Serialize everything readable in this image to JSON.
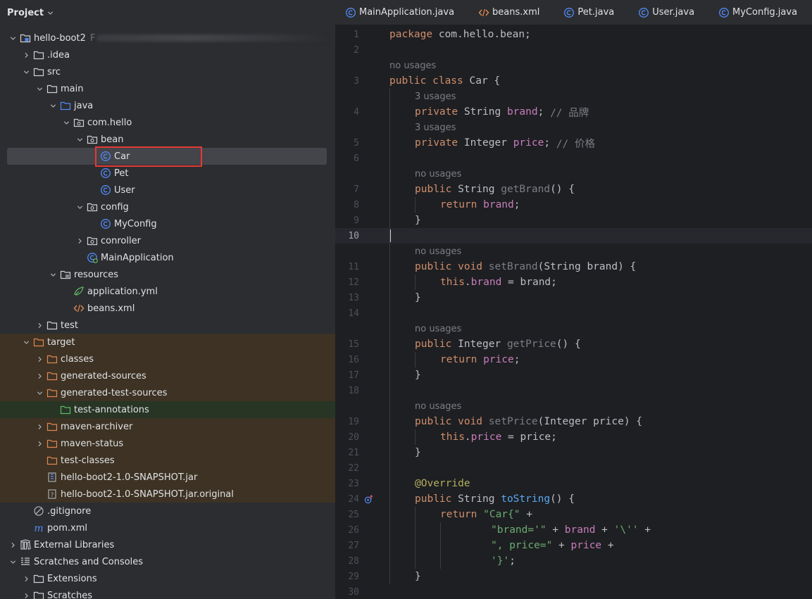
{
  "project_panel": {
    "title": "Project",
    "tree": [
      {
        "label": "hello-boot2",
        "suffix": "F",
        "icon": "module-folder-icon",
        "depth": 0,
        "expanded": true,
        "blurred_path": true
      },
      {
        "label": ".idea",
        "icon": "folder-icon",
        "depth": 1,
        "expanded": false
      },
      {
        "label": "src",
        "icon": "folder-icon",
        "depth": 1,
        "expanded": true
      },
      {
        "label": "main",
        "icon": "folder-icon",
        "depth": 2,
        "expanded": true
      },
      {
        "label": "java",
        "icon": "source-folder-icon",
        "depth": 3,
        "expanded": true
      },
      {
        "label": "com.hello",
        "icon": "package-icon",
        "depth": 4,
        "expanded": true
      },
      {
        "label": "bean",
        "icon": "package-icon",
        "depth": 5,
        "expanded": true
      },
      {
        "label": "Car",
        "icon": "class-icon",
        "depth": 6,
        "leaf": true,
        "selected": true
      },
      {
        "label": "Pet",
        "icon": "class-icon",
        "depth": 6,
        "leaf": true
      },
      {
        "label": "User",
        "icon": "class-icon",
        "depth": 6,
        "leaf": true
      },
      {
        "label": "config",
        "icon": "package-icon",
        "depth": 5,
        "expanded": true
      },
      {
        "label": "MyConfig",
        "icon": "class-icon",
        "depth": 6,
        "leaf": true
      },
      {
        "label": "conroller",
        "icon": "package-icon",
        "depth": 5,
        "expanded": false
      },
      {
        "label": "MainApplication",
        "icon": "spring-class-icon",
        "depth": 5,
        "leaf": true
      },
      {
        "label": "resources",
        "icon": "resources-folder-icon",
        "depth": 3,
        "expanded": true
      },
      {
        "label": "application.yml",
        "icon": "spring-config-icon",
        "depth": 4,
        "leaf": true
      },
      {
        "label": "beans.xml",
        "icon": "xml-icon",
        "depth": 4,
        "leaf": true
      },
      {
        "label": "test",
        "icon": "folder-icon",
        "depth": 2,
        "expanded": false
      },
      {
        "label": "target",
        "icon": "excluded-folder-icon",
        "depth": 1,
        "expanded": true,
        "bg": "target"
      },
      {
        "label": "classes",
        "icon": "excluded-folder-icon",
        "depth": 2,
        "expanded": false,
        "bg": "target"
      },
      {
        "label": "generated-sources",
        "icon": "excluded-folder-icon",
        "depth": 2,
        "expanded": false,
        "bg": "target"
      },
      {
        "label": "generated-test-sources",
        "icon": "excluded-folder-icon",
        "depth": 2,
        "expanded": true,
        "bg": "target"
      },
      {
        "label": "test-annotations",
        "icon": "generated-test-folder-icon",
        "depth": 3,
        "leaf": true,
        "bg": "green"
      },
      {
        "label": "maven-archiver",
        "icon": "excluded-folder-icon",
        "depth": 2,
        "expanded": false,
        "bg": "target"
      },
      {
        "label": "maven-status",
        "icon": "excluded-folder-icon",
        "depth": 2,
        "expanded": false,
        "bg": "target"
      },
      {
        "label": "test-classes",
        "icon": "excluded-folder-icon",
        "depth": 2,
        "leaf": true,
        "bg": "target"
      },
      {
        "label": "hello-boot2-1.0-SNAPSHOT.jar",
        "icon": "jar-icon",
        "depth": 2,
        "leaf": true,
        "bg": "target"
      },
      {
        "label": "hello-boot2-1.0-SNAPSHOT.jar.original",
        "icon": "unknown-file-icon",
        "depth": 2,
        "leaf": true,
        "bg": "target"
      },
      {
        "label": ".gitignore",
        "icon": "gitignore-icon",
        "depth": 1,
        "leaf": true
      },
      {
        "label": "pom.xml",
        "icon": "maven-icon",
        "depth": 1,
        "leaf": true
      },
      {
        "label": "External Libraries",
        "icon": "libraries-icon",
        "depth": 0,
        "expanded": false
      },
      {
        "label": "Scratches and Consoles",
        "icon": "scratches-icon",
        "depth": 0,
        "expanded": true
      },
      {
        "label": "Extensions",
        "icon": "folder-icon",
        "depth": 1,
        "expanded": false
      },
      {
        "label": "Scratches",
        "icon": "folder-icon",
        "depth": 1,
        "expanded": false
      }
    ]
  },
  "editor": {
    "tabs": [
      {
        "label": "MainApplication.java",
        "icon": "class-icon"
      },
      {
        "label": "beans.xml",
        "icon": "xml-icon"
      },
      {
        "label": "Pet.java",
        "icon": "class-icon"
      },
      {
        "label": "User.java",
        "icon": "class-icon"
      },
      {
        "label": "MyConfig.java",
        "icon": "class-icon"
      }
    ],
    "current_line": "10",
    "lines": [
      {
        "n": "1",
        "indent": 0,
        "parts": [
          [
            "kw",
            "package"
          ],
          [
            "code",
            " com.hello.bean;"
          ]
        ]
      },
      {
        "n": "2",
        "indent": 0,
        "parts": []
      },
      {
        "hint": "no usages",
        "indent": 0
      },
      {
        "n": "3",
        "indent": 0,
        "parts": [
          [
            "kw",
            "public class "
          ],
          [
            "cls",
            "Car "
          ],
          [
            "code",
            "{"
          ]
        ]
      },
      {
        "hint": "3 usages",
        "indent": 1
      },
      {
        "n": "4",
        "indent": 1,
        "parts": [
          [
            "kw",
            "private "
          ],
          [
            "code",
            "String "
          ],
          [
            "fld",
            "brand"
          ],
          [
            "code",
            "; "
          ],
          [
            "cmt",
            "// 品牌"
          ]
        ]
      },
      {
        "hint": "3 usages",
        "indent": 1
      },
      {
        "n": "5",
        "indent": 1,
        "parts": [
          [
            "kw",
            "private "
          ],
          [
            "code",
            "Integer "
          ],
          [
            "fld",
            "price"
          ],
          [
            "code",
            "; "
          ],
          [
            "cmt",
            "// 价格"
          ]
        ]
      },
      {
        "n": "6",
        "indent": 0,
        "parts": []
      },
      {
        "hint": "no usages",
        "indent": 1
      },
      {
        "n": "7",
        "indent": 1,
        "parts": [
          [
            "kw",
            "public "
          ],
          [
            "code",
            "String "
          ],
          [
            "cmt",
            "getBrand"
          ],
          [
            "code",
            "() {"
          ]
        ]
      },
      {
        "n": "8",
        "indent": 2,
        "parts": [
          [
            "kw",
            "return "
          ],
          [
            "fld",
            "brand"
          ],
          [
            "code",
            ";"
          ]
        ]
      },
      {
        "n": "9",
        "indent": 1,
        "parts": [
          [
            "code",
            "}"
          ]
        ]
      },
      {
        "n": "10",
        "indent": 0,
        "parts": [],
        "current": true
      },
      {
        "hint": "no usages",
        "indent": 1
      },
      {
        "n": "11",
        "indent": 1,
        "parts": [
          [
            "kw",
            "public void "
          ],
          [
            "cmt",
            "setBrand"
          ],
          [
            "code",
            "(String brand) {"
          ]
        ]
      },
      {
        "n": "12",
        "indent": 2,
        "parts": [
          [
            "kw",
            "this"
          ],
          [
            "code",
            "."
          ],
          [
            "fld",
            "brand"
          ],
          [
            "code",
            " = brand;"
          ]
        ]
      },
      {
        "n": "13",
        "indent": 1,
        "parts": [
          [
            "code",
            "}"
          ]
        ]
      },
      {
        "n": "14",
        "indent": 0,
        "parts": []
      },
      {
        "hint": "no usages",
        "indent": 1
      },
      {
        "n": "15",
        "indent": 1,
        "parts": [
          [
            "kw",
            "public "
          ],
          [
            "code",
            "Integer "
          ],
          [
            "cmt",
            "getPrice"
          ],
          [
            "code",
            "() {"
          ]
        ]
      },
      {
        "n": "16",
        "indent": 2,
        "parts": [
          [
            "kw",
            "return "
          ],
          [
            "fld",
            "price"
          ],
          [
            "code",
            ";"
          ]
        ]
      },
      {
        "n": "17",
        "indent": 1,
        "parts": [
          [
            "code",
            "}"
          ]
        ]
      },
      {
        "n": "18",
        "indent": 0,
        "parts": []
      },
      {
        "hint": "no usages",
        "indent": 1
      },
      {
        "n": "19",
        "indent": 1,
        "parts": [
          [
            "kw",
            "public void "
          ],
          [
            "cmt",
            "setPrice"
          ],
          [
            "code",
            "(Integer price) {"
          ]
        ]
      },
      {
        "n": "20",
        "indent": 2,
        "parts": [
          [
            "kw",
            "this"
          ],
          [
            "code",
            "."
          ],
          [
            "fld",
            "price"
          ],
          [
            "code",
            " = price;"
          ]
        ]
      },
      {
        "n": "21",
        "indent": 1,
        "parts": [
          [
            "code",
            "}"
          ]
        ]
      },
      {
        "n": "22",
        "indent": 0,
        "parts": []
      },
      {
        "n": "23",
        "indent": 1,
        "parts": [
          [
            "ann",
            "@Override"
          ]
        ]
      },
      {
        "n": "24",
        "indent": 1,
        "parts": [
          [
            "kw",
            "public "
          ],
          [
            "code",
            "String "
          ],
          [
            "fn",
            "toString"
          ],
          [
            "code",
            "() {"
          ]
        ],
        "gutter_icon": "override-icon"
      },
      {
        "n": "25",
        "indent": 2,
        "parts": [
          [
            "kw",
            "return "
          ],
          [
            "str",
            "\"Car{\""
          ],
          [
            "code",
            " +"
          ]
        ]
      },
      {
        "n": "26",
        "indent": 4,
        "parts": [
          [
            "str",
            "\"brand='\""
          ],
          [
            "code",
            " + "
          ],
          [
            "fld",
            "brand"
          ],
          [
            "code",
            " + "
          ],
          [
            "str",
            "'\\''"
          ],
          [
            "code",
            " +"
          ]
        ]
      },
      {
        "n": "27",
        "indent": 4,
        "parts": [
          [
            "str",
            "\", price=\""
          ],
          [
            "code",
            " + "
          ],
          [
            "fld",
            "price"
          ],
          [
            "code",
            " +"
          ]
        ]
      },
      {
        "n": "28",
        "indent": 4,
        "parts": [
          [
            "str",
            "'}'"
          ],
          [
            "code",
            ";"
          ]
        ]
      },
      {
        "n": "29",
        "indent": 1,
        "parts": [
          [
            "code",
            "}"
          ]
        ]
      },
      {
        "n": "30",
        "indent": 0,
        "parts": []
      }
    ]
  }
}
